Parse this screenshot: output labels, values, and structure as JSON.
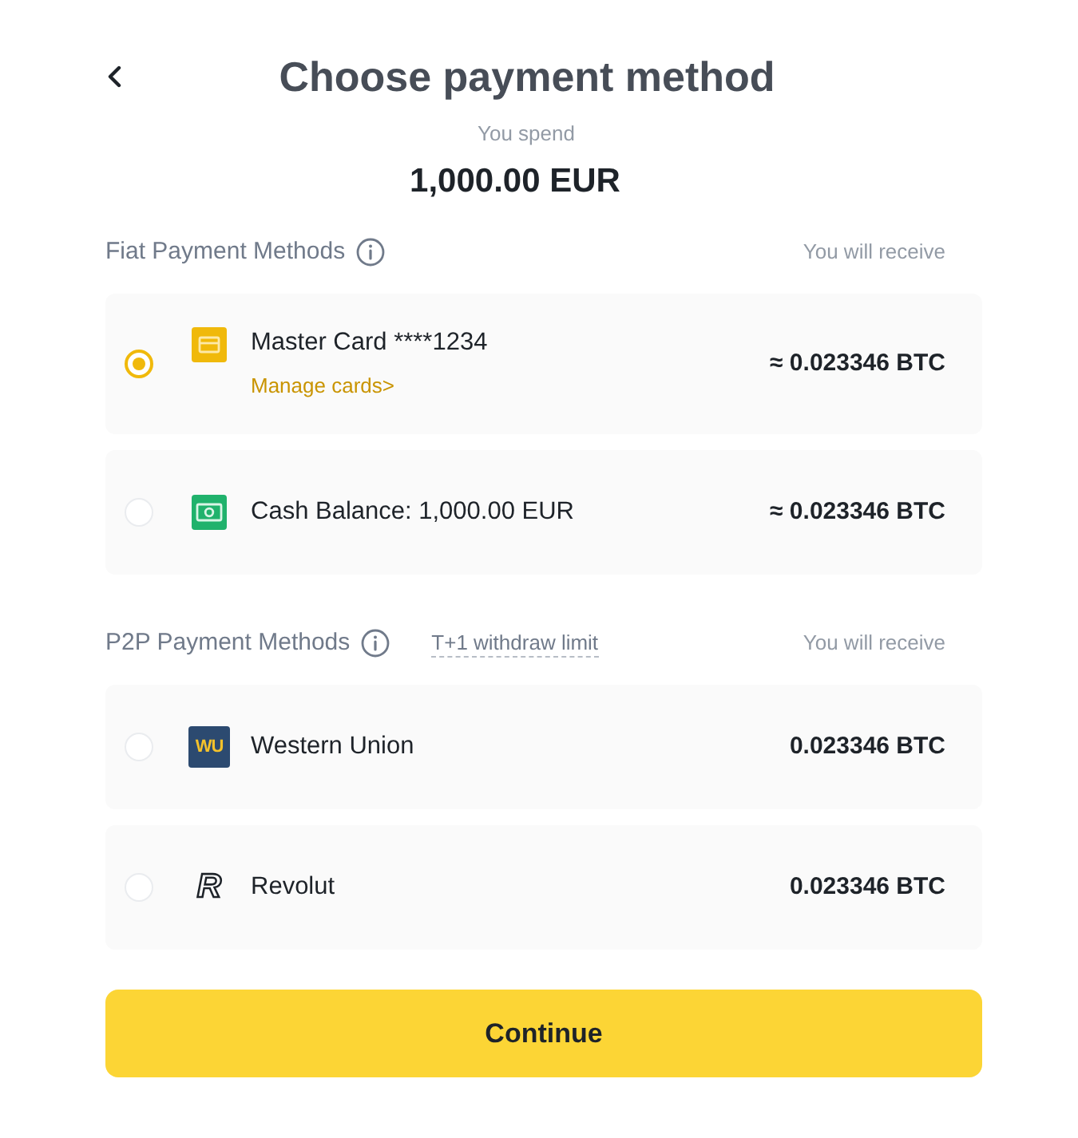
{
  "header": {
    "title": "Choose payment method"
  },
  "spend": {
    "label": "You spend",
    "amount": "1,000.00 EUR"
  },
  "sections": [
    {
      "title": "Fiat Payment Methods",
      "receive_label": "You will receive",
      "methods": [
        {
          "kind": "card",
          "name": "Master Card ****1234",
          "link": "Manage cards>",
          "amount": "≈ 0.023346 BTC",
          "selected": true
        },
        {
          "kind": "cash",
          "name": "Cash Balance: 1,000.00 EUR",
          "amount": "≈ 0.023346 BTC",
          "selected": false
        }
      ]
    },
    {
      "title": "P2P Payment Methods",
      "note": "T+1 withdraw limit",
      "receive_label": "You will receive",
      "methods": [
        {
          "kind": "tile",
          "logo_text": "WU",
          "name": "Western Union",
          "amount": "0.023346 BTC",
          "selected": false
        },
        {
          "kind": "letter",
          "logo_text": "R",
          "name": "Revolut",
          "amount": "0.023346 BTC",
          "selected": false
        }
      ]
    }
  ],
  "button": {
    "label": "Continue"
  }
}
